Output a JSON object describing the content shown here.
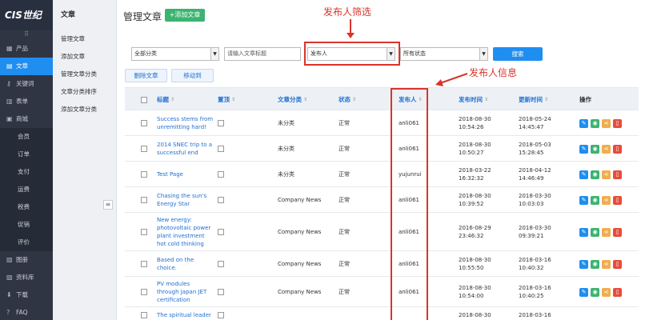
{
  "sidebar": {
    "logo": "CIS世纪",
    "grip": "⠿",
    "items": [
      {
        "label": "产品",
        "icon": "grid-icon"
      },
      {
        "label": "文章",
        "icon": "document-icon",
        "active": true
      },
      {
        "label": "关键词",
        "icon": "key-icon"
      },
      {
        "label": "表单",
        "icon": "form-icon"
      },
      {
        "label": "商城",
        "icon": "shop-icon"
      },
      {
        "label": "会员",
        "sub": true
      },
      {
        "label": "订单",
        "sub": true
      },
      {
        "label": "支付",
        "sub": true
      },
      {
        "label": "运费",
        "sub": true
      },
      {
        "label": "税费",
        "sub": true
      },
      {
        "label": "促销",
        "sub": true
      },
      {
        "label": "评价",
        "sub": true
      },
      {
        "label": "图册",
        "icon": "image-icon"
      },
      {
        "label": "资料库",
        "icon": "database-icon"
      },
      {
        "label": "下载",
        "icon": "download-icon"
      },
      {
        "label": "FAQ",
        "icon": "help-icon"
      }
    ]
  },
  "submenu": {
    "title": "文章",
    "items": [
      "管理文章",
      "添加文章",
      "管理文章分类",
      "文章分类排序",
      "添加文章分类"
    ]
  },
  "main": {
    "page_title": "管理文章",
    "add_button": "+添加文章"
  },
  "filters": {
    "category": "全部分类",
    "title_placeholder": "请输入文章标题",
    "publisher": "发布人",
    "status": "所有状态",
    "search": "搜索"
  },
  "actions": {
    "delete": "删除文章",
    "move": "移动到"
  },
  "table": {
    "headers": {
      "title": "标题",
      "top": "置顶",
      "category": "文章分类",
      "status": "状态",
      "publisher": "发布人",
      "publish_time": "发布时间",
      "update_time": "更新时间",
      "ops": "操作"
    },
    "rows": [
      {
        "title": [
          "Success stems from",
          "unremitting hard!"
        ],
        "category": "未分类",
        "status": "正常",
        "publisher": "anli061",
        "publish_time": [
          "2018-08-30",
          "10:54:26"
        ],
        "update_time": [
          "2018-05-24",
          "14:45:47"
        ]
      },
      {
        "title": [
          "2014 SNEC trip to a",
          "successful end"
        ],
        "category": "未分类",
        "status": "正常",
        "publisher": "anli061",
        "publish_time": [
          "2018-08-30",
          "10:50:27"
        ],
        "update_time": [
          "2018-05-03",
          "15:28:45"
        ]
      },
      {
        "title": [
          "Test Page"
        ],
        "category": "未分类",
        "status": "正常",
        "publisher": "yujunrui",
        "publish_time": [
          "2018-03-22",
          "16:32:32"
        ],
        "update_time": [
          "2018-04-12",
          "14:46:49"
        ]
      },
      {
        "title": [
          "Chasing the sun's",
          "Energy Star"
        ],
        "category": "Company News",
        "status": "正常",
        "publisher": "anli061",
        "publish_time": [
          "2018-08-30",
          "10:39:52"
        ],
        "update_time": [
          "2018-03-30",
          "10:03:03"
        ]
      },
      {
        "title": [
          "New energy:",
          "photovoltaic power",
          "plant investment",
          "hot cold thinking"
        ],
        "category": "Company News",
        "status": "正常",
        "publisher": "anli061",
        "publish_time": [
          "2016-08-29",
          "23:46:32"
        ],
        "update_time": [
          "2018-03-30",
          "09:39:21"
        ]
      },
      {
        "title": [
          "Based on the",
          "choice."
        ],
        "category": "Company News",
        "status": "正常",
        "publisher": "anli061",
        "publish_time": [
          "2018-08-30",
          "10:55:50"
        ],
        "update_time": [
          "2018-03-16",
          "10:40:32"
        ]
      },
      {
        "title": [
          "PV modules",
          "through Japan JET",
          "certification"
        ],
        "category": "Company News",
        "status": "正常",
        "publisher": "anli061",
        "publish_time": [
          "2018-08-30",
          "10:54:00"
        ],
        "update_time": [
          "2018-03-16",
          "10:40:25"
        ]
      },
      {
        "title": [
          "The spiritual leader"
        ],
        "category": "",
        "status": "",
        "publisher": "",
        "publish_time": [
          "2018-08-30"
        ],
        "update_time": [
          "2018-03-16"
        ]
      }
    ]
  },
  "annotations": {
    "filter_label": "发布人筛选",
    "column_label": "发布人信息"
  },
  "colors": {
    "sidebar_bg": "#2f3542",
    "accent": "#1f8ef1",
    "add_green": "#3cb371",
    "annotation_red": "#d9342b"
  }
}
